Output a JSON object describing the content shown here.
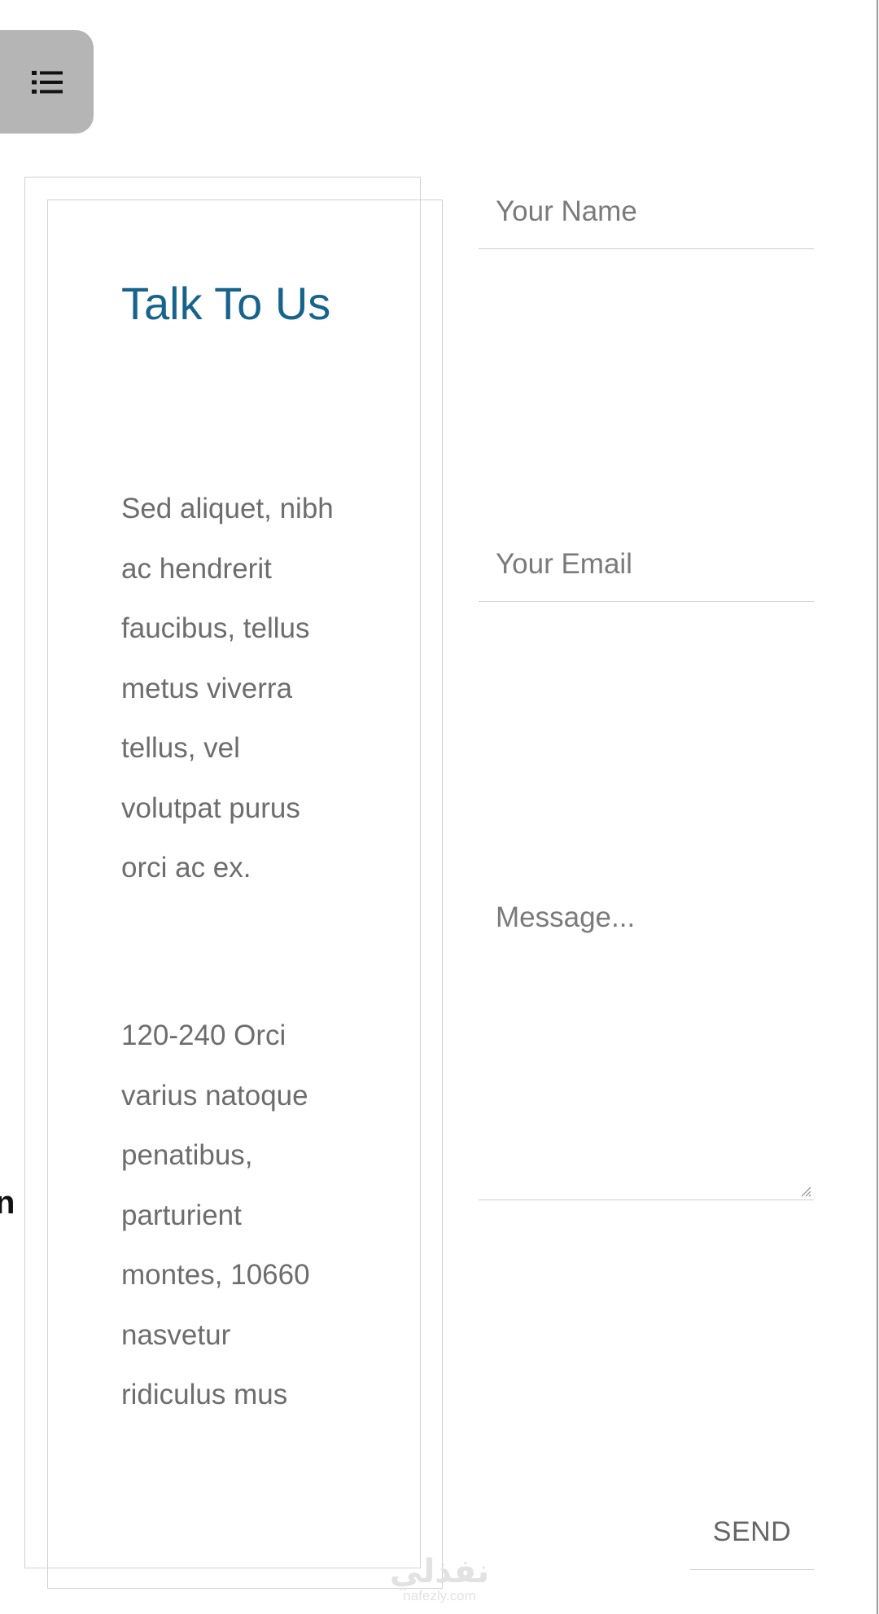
{
  "menu": {
    "icon": "list-icon"
  },
  "info": {
    "title": "Talk To Us",
    "paragraph_1": "Sed aliquet, nibh ac hendrerit faucibus, tellus metus viverra tellus, vel volutpat purus orci ac ex.",
    "paragraph_2": "120-240 Orci varius natoque penatibus, parturient montes, 10660 nasvetur ridiculus mus"
  },
  "form": {
    "name_placeholder": "Your Name",
    "email_placeholder": "Your Email",
    "message_placeholder": "Message...",
    "send_label": "SEND"
  },
  "edge_glyph": "n",
  "watermark": {
    "main": "نفذلي",
    "sub": "nafezly.com"
  },
  "colors": {
    "title": "#17638c",
    "body_text": "#6d6d6d",
    "menu_bg": "#b5b5b5",
    "border": "#d2d2d2"
  }
}
